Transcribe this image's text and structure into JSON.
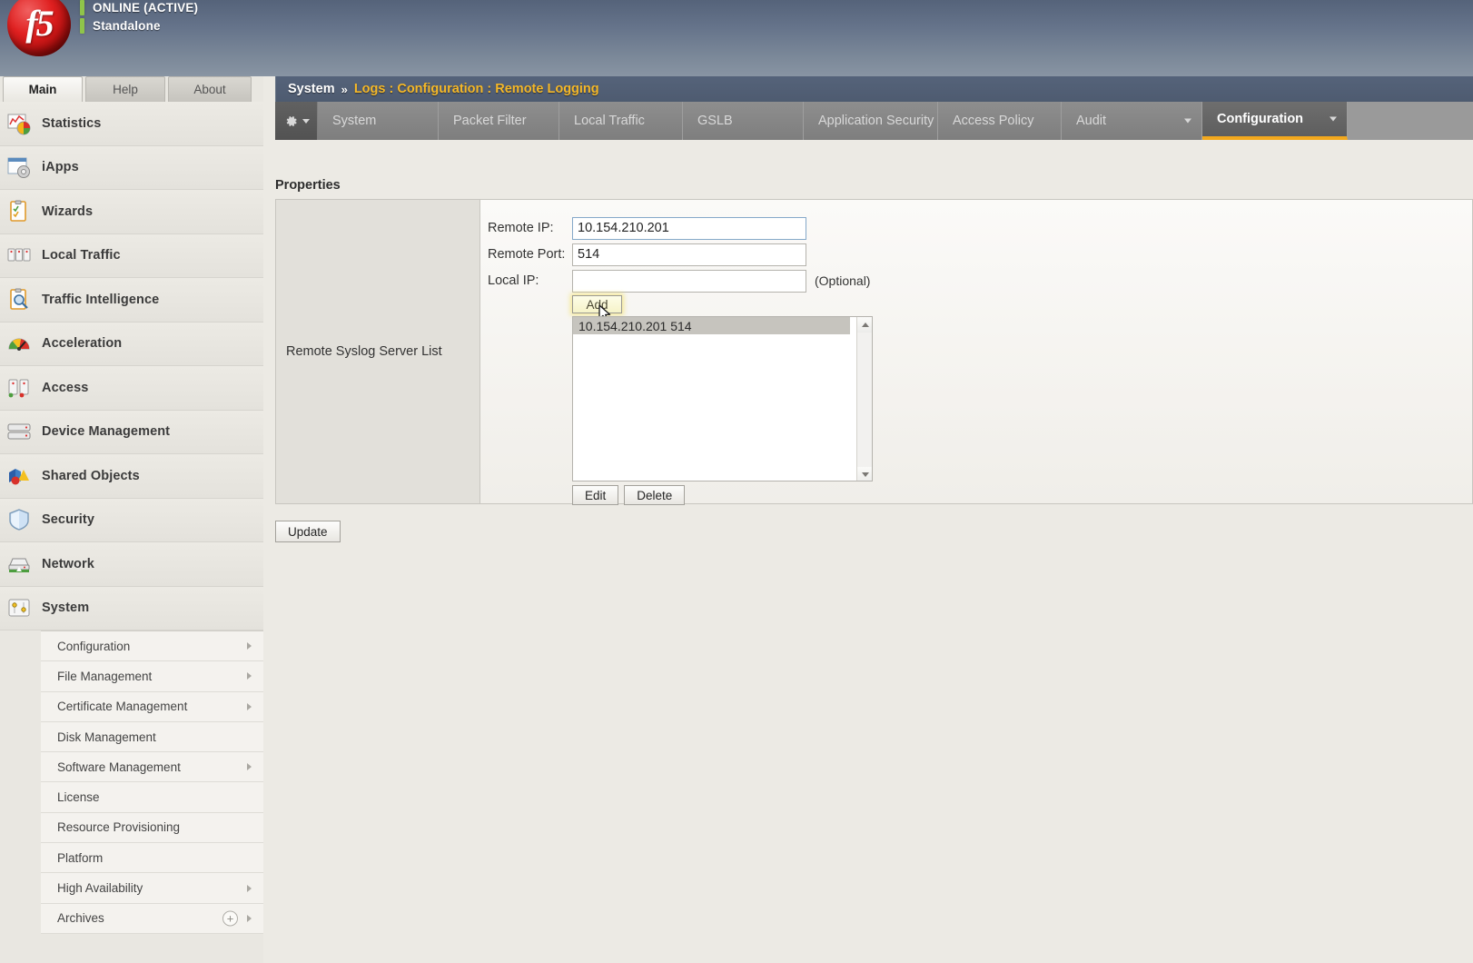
{
  "header": {
    "logo_text": "f5",
    "status_online": "ONLINE (ACTIVE)",
    "status_mode": "Standalone"
  },
  "main_tabs": [
    {
      "label": "Main",
      "active": true
    },
    {
      "label": "Help",
      "active": false
    },
    {
      "label": "About",
      "active": false
    }
  ],
  "sidebar": {
    "items": [
      {
        "label": "Statistics",
        "icon": "statistics-icon"
      },
      {
        "label": "iApps",
        "icon": "iapps-icon"
      },
      {
        "label": "Wizards",
        "icon": "wizards-icon"
      },
      {
        "label": "Local Traffic",
        "icon": "local-traffic-icon"
      },
      {
        "label": "Traffic Intelligence",
        "icon": "traffic-intelligence-icon"
      },
      {
        "label": "Acceleration",
        "icon": "acceleration-icon"
      },
      {
        "label": "Access",
        "icon": "access-icon"
      },
      {
        "label": "Device Management",
        "icon": "device-management-icon"
      },
      {
        "label": "Shared Objects",
        "icon": "shared-objects-icon"
      },
      {
        "label": "Security",
        "icon": "security-icon"
      },
      {
        "label": "Network",
        "icon": "network-icon"
      },
      {
        "label": "System",
        "icon": "system-icon"
      }
    ],
    "submenu": [
      {
        "label": "Configuration",
        "has_arrow": true,
        "has_plus": false
      },
      {
        "label": "File Management",
        "has_arrow": true,
        "has_plus": false
      },
      {
        "label": "Certificate Management",
        "has_arrow": true,
        "has_plus": false
      },
      {
        "label": "Disk Management",
        "has_arrow": false,
        "has_plus": false
      },
      {
        "label": "Software Management",
        "has_arrow": true,
        "has_plus": false
      },
      {
        "label": "License",
        "has_arrow": false,
        "has_plus": false
      },
      {
        "label": "Resource Provisioning",
        "has_arrow": false,
        "has_plus": false
      },
      {
        "label": "Platform",
        "has_arrow": false,
        "has_plus": false
      },
      {
        "label": "High Availability",
        "has_arrow": true,
        "has_plus": false
      },
      {
        "label": "Archives",
        "has_arrow": true,
        "has_plus": true,
        "plus_glyph": "+"
      }
    ]
  },
  "breadcrumb": {
    "root": "System",
    "separator": "»",
    "path": "Logs : Configuration : Remote Logging"
  },
  "content_tabs": [
    {
      "label": "System",
      "active": false,
      "caret": false
    },
    {
      "label": "Packet Filter",
      "active": false,
      "caret": false
    },
    {
      "label": "Local Traffic",
      "active": false,
      "caret": false
    },
    {
      "label": "GSLB",
      "active": false,
      "caret": false
    },
    {
      "label": "Application Security",
      "active": false,
      "caret": false
    },
    {
      "label": "Access Policy",
      "active": false,
      "caret": false
    },
    {
      "label": "Audit",
      "active": false,
      "caret": true
    },
    {
      "label": "Configuration",
      "active": true,
      "caret": true
    }
  ],
  "main": {
    "properties_title": "Properties",
    "row_label": "Remote Syslog Server List",
    "fields": [
      {
        "label": "Remote IP:",
        "value": "10.154.210.201",
        "note": "",
        "focused": true
      },
      {
        "label": "Remote Port:",
        "value": "514",
        "note": "",
        "focused": false
      },
      {
        "label": "Local IP:",
        "value": "",
        "note": "(Optional)",
        "focused": false
      }
    ],
    "add_label": "Add",
    "server_list": [
      "10.154.210.201 514"
    ],
    "edit_label": "Edit",
    "delete_label": "Delete",
    "update_label": "Update"
  },
  "colors": {
    "header_blue": "#55637a",
    "accent_gold": "#f5b828",
    "active_tab_underline": "#f2a81d",
    "status_green": "#8fc44a",
    "logo_red": "#d01818",
    "highlight_yellow": "#f6f3c8"
  }
}
